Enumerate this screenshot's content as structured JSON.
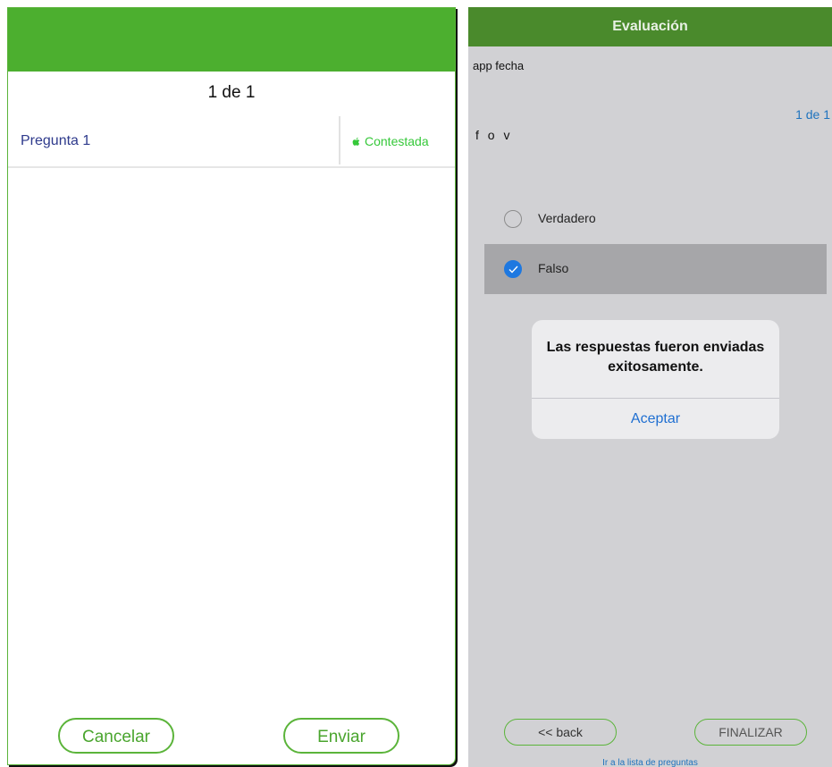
{
  "left_screen": {
    "counter": "1 de 1",
    "question": {
      "label": "Pregunta 1",
      "status": "Contestada"
    },
    "buttons": {
      "cancel_label": "Cancelar",
      "send_label": "Enviar"
    },
    "colors": {
      "header": "#4caf2f",
      "accent": "#5bb43a",
      "status": "#36c83a"
    }
  },
  "right_screen": {
    "header_title": "Evaluación",
    "subtitle": "app fecha",
    "counter": "1 de 1",
    "question_text": "f o v",
    "options": [
      {
        "label": "Verdadero",
        "selected": false
      },
      {
        "label": "Falso",
        "selected": true
      }
    ],
    "dialog": {
      "message": "Las respuestas fueron enviadas exitosamente.",
      "accept_label": "Aceptar"
    },
    "buttons": {
      "back_label": "<< back",
      "finish_label": "FINALIZAR"
    },
    "link_text": "Ir a la lista de preguntas",
    "colors": {
      "header": "#4a8a2c",
      "background": "#d1d1d4",
      "link": "#1e73be",
      "radio_selected": "#1e78e0"
    }
  }
}
